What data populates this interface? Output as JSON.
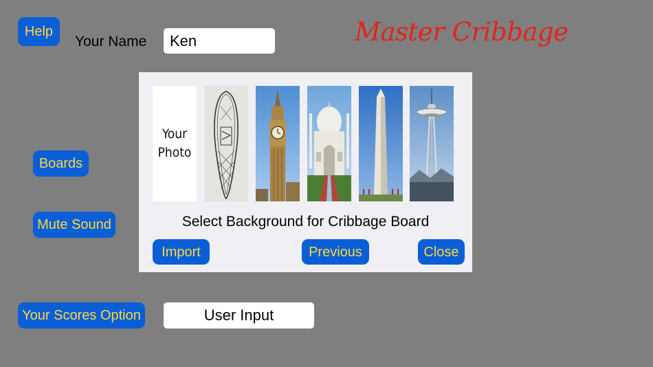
{
  "header": {
    "help_label": "Help",
    "name_label": "Your Name",
    "name_value": "Ken",
    "app_title": "Master Cribbage"
  },
  "side_buttons": {
    "boards_label": "Boards",
    "mute_label": "Mute Sound",
    "scores_option_label": "Your Scores Option",
    "scores_option_value": "User Input"
  },
  "background_dialog": {
    "photo_thumb_line1": "Your",
    "photo_thumb_line2": "Photo",
    "thumbnails": [
      "photo",
      "snowshoe",
      "big-ben",
      "taj-mahal",
      "washington-monument",
      "space-needle"
    ],
    "caption": "Select Background for Cribbage Board",
    "import_label": "Import",
    "previous_label": "Previous",
    "close_label": "Close"
  },
  "colors": {
    "background": "#7f7f7f",
    "button_fill": "#0a5fd6",
    "button_text": "#ffd83a",
    "title": "#e1251b",
    "dialog": "#efeff4"
  }
}
